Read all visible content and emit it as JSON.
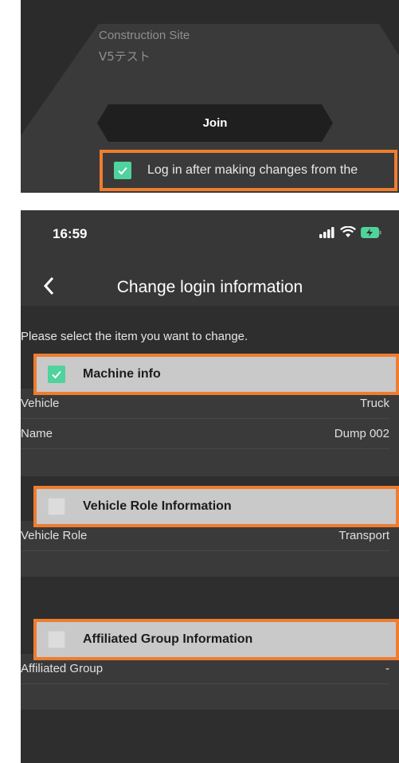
{
  "login_panel": {
    "site_label": "Construction Site",
    "site_value": "V5テスト",
    "join_label": "Join",
    "login_after_change_label": "Log in after making changes from the",
    "login_after_change_checked": true
  },
  "status_bar": {
    "time": "16:59",
    "signal_icon": "cellular-signal-icon",
    "wifi_icon": "wifi-icon",
    "battery_icon": "battery-charging-icon"
  },
  "nav": {
    "back_icon": "chevron-left-icon",
    "title": "Change login information"
  },
  "instruction": "Please select the item you want to change.",
  "sections": {
    "machine": {
      "title": "Machine info",
      "checked": true,
      "rows": [
        {
          "label": "Vehicle",
          "value": "Truck"
        },
        {
          "label": "Name",
          "value": "Dump 002"
        }
      ]
    },
    "role": {
      "title": "Vehicle Role Information",
      "checked": false,
      "rows": [
        {
          "label": "Vehicle Role",
          "value": "Transport"
        }
      ]
    },
    "group": {
      "title": "Affiliated Group Information",
      "checked": false,
      "rows": [
        {
          "label": "Affiliated Group",
          "value": "-"
        }
      ]
    }
  },
  "colors": {
    "highlight": "#ef7d2f",
    "check_green": "#4fd29b",
    "header_gray": "#c9c9c9",
    "panel_dark": "#2e2e2e"
  }
}
